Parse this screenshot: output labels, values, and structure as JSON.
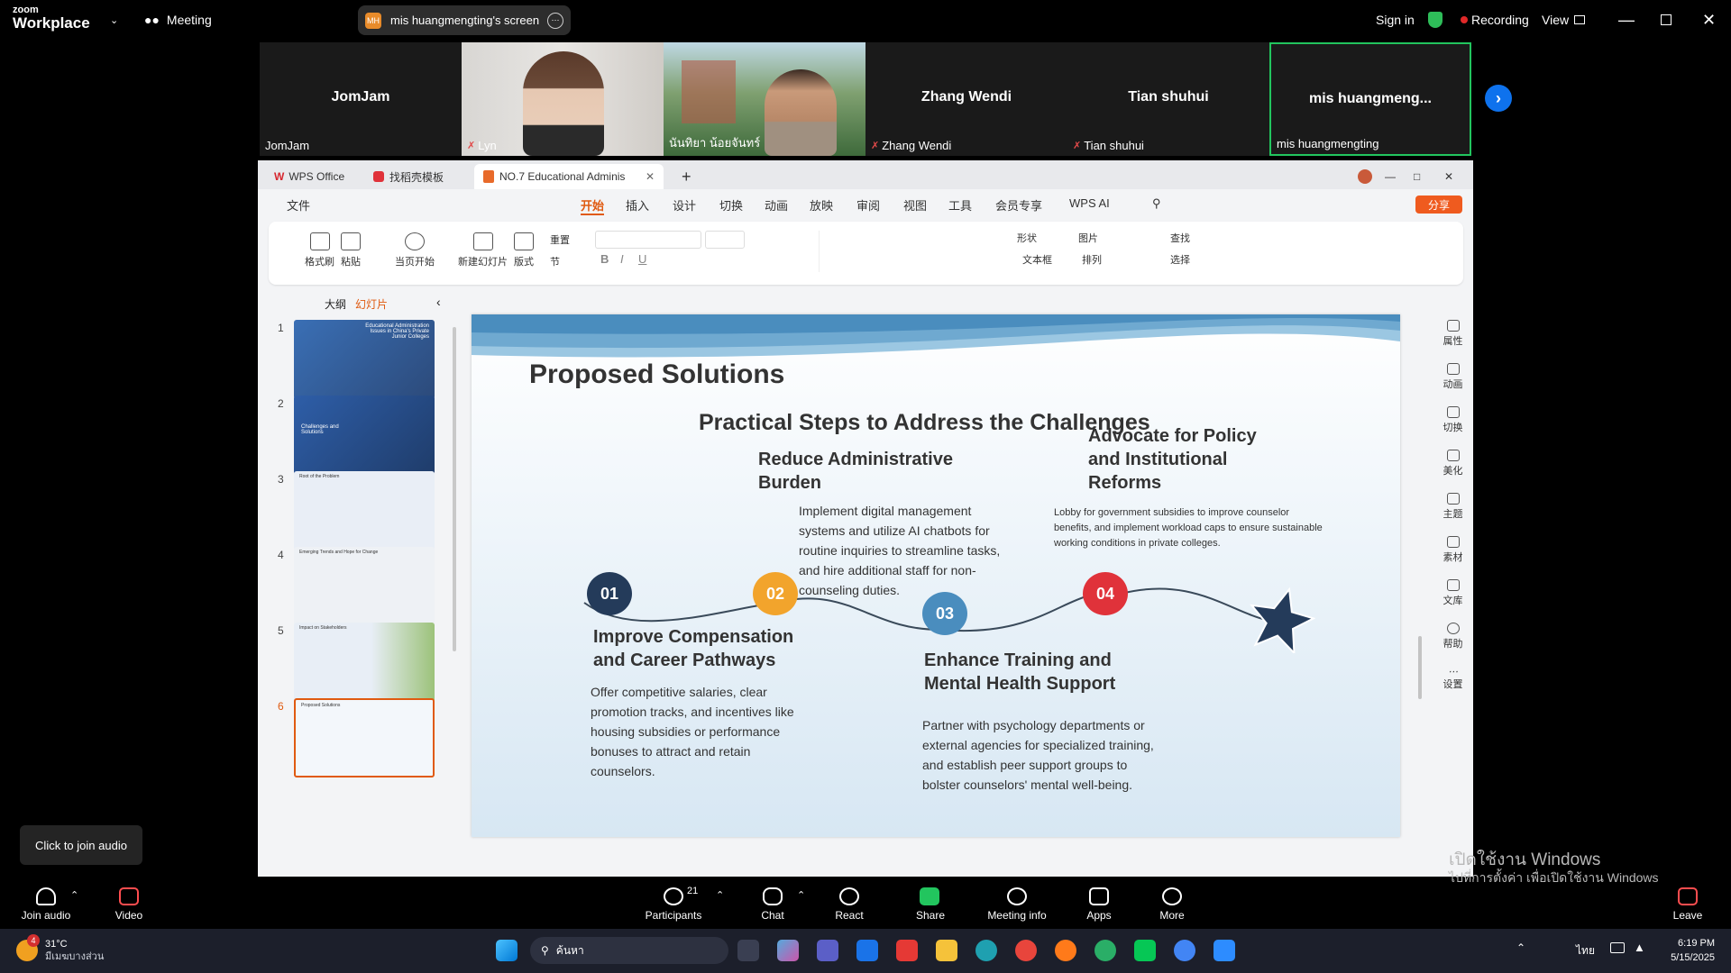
{
  "zoom": {
    "logo_top": "zoom",
    "logo_bottom": "Workplace",
    "meeting_label": "Meeting",
    "share_badge": "MH",
    "share_title": "mis huangmengting's screen",
    "sign_in": "Sign in",
    "recording": "Recording",
    "view": "View"
  },
  "gallery": [
    {
      "name": "JomJam",
      "label": "JomJam",
      "video": false
    },
    {
      "name": "",
      "label": "Lyn",
      "video": true
    },
    {
      "name": "",
      "label": "นันทิยา น้อยจันทร์",
      "video": true
    },
    {
      "name": "Zhang Wendi",
      "label": "Zhang Wendi",
      "video": false
    },
    {
      "name": "Tian shuhui",
      "label": "Tian shuhui",
      "video": false
    },
    {
      "name": "mis  huangmeng...",
      "label": "mis huangmengting",
      "video": false
    }
  ],
  "wps": {
    "tabs": [
      "WPS Office",
      "找稻壳模板",
      "NO.7 Educational Adminis"
    ],
    "menu": [
      "文件",
      "开始",
      "插入",
      "设计",
      "切换",
      "动画",
      "放映",
      "审阅",
      "视图",
      "工具",
      "会员专享",
      "WPS AI"
    ],
    "share_btn": "分享",
    "ribbon": [
      "格式刷",
      "粘贴",
      "当页开始",
      "新建幻灯片",
      "版式",
      "节",
      "重置",
      "形状",
      "图片",
      "查找",
      "文本框",
      "排列",
      "选择"
    ],
    "panel_tabs": [
      "大纲",
      "幻灯片"
    ],
    "thumbs": [
      {
        "num": "1",
        "title": "Educational Administration Issues in China's Private Junior Colleges"
      },
      {
        "num": "2",
        "title": "Challenges and Solutions"
      },
      {
        "num": "3",
        "title": "Root of the Problem"
      },
      {
        "num": "4",
        "title": "Emerging Trends and Hope for Change"
      },
      {
        "num": "5",
        "title": "Impact on Stakeholders"
      },
      {
        "num": "6",
        "title": "Proposed Solutions"
      }
    ],
    "right_panel": [
      "属性",
      "动画",
      "切换",
      "美化",
      "主题",
      "素材",
      "文库",
      "帮助",
      "设置"
    ]
  },
  "slide": {
    "title": "Proposed Solutions",
    "subtitle": "Practical Steps to Address the Challenges",
    "steps": [
      {
        "num": "01",
        "heading": "Improve Compensation and Career Pathways",
        "body": "Offer competitive salaries, clear promotion tracks, and incentives like housing subsidies or performance bonuses to attract and retain counselors.",
        "color": "#243b5a"
      },
      {
        "num": "02",
        "heading": "Reduce Administrative Burden",
        "body": "Implement digital management systems and utilize AI chatbots for routine inquiries to streamline tasks, and hire additional staff for non-counseling duties.",
        "color": "#f2a42c"
      },
      {
        "num": "03",
        "heading": "Enhance Training and Mental Health Support",
        "body": "Partner with psychology departments or external agencies for specialized training, and establish peer support groups to bolster counselors' mental well-being.",
        "color": "#4a8dbe"
      },
      {
        "num": "04",
        "heading": "Advocate for Policy and Institutional Reforms",
        "body": "Lobby for government subsidies to improve counselor benefits, and implement workload caps to ensure sustainable working conditions in private colleges.",
        "color": "#e0323a"
      }
    ]
  },
  "tooltip": "Click to join audio",
  "toolbar": {
    "join_audio": "Join audio",
    "video": "Video",
    "participants": "Participants",
    "participants_count": "21",
    "chat": "Chat",
    "react": "React",
    "share": "Share",
    "meeting_info": "Meeting info",
    "apps": "Apps",
    "more": "More",
    "leave": "Leave"
  },
  "watermark": {
    "line1": "เปิดใช้งาน Windows",
    "line2": "ไปที่การตั้งค่า เพื่อเปิดใช้งาน Windows"
  },
  "taskbar": {
    "weather_badge": "4",
    "temp": "31°C",
    "weather": "มีเมฆบางส่วน",
    "search": "ค้นหา",
    "lang": "ไทย",
    "time": "6:19 PM",
    "date": "5/15/2025"
  }
}
